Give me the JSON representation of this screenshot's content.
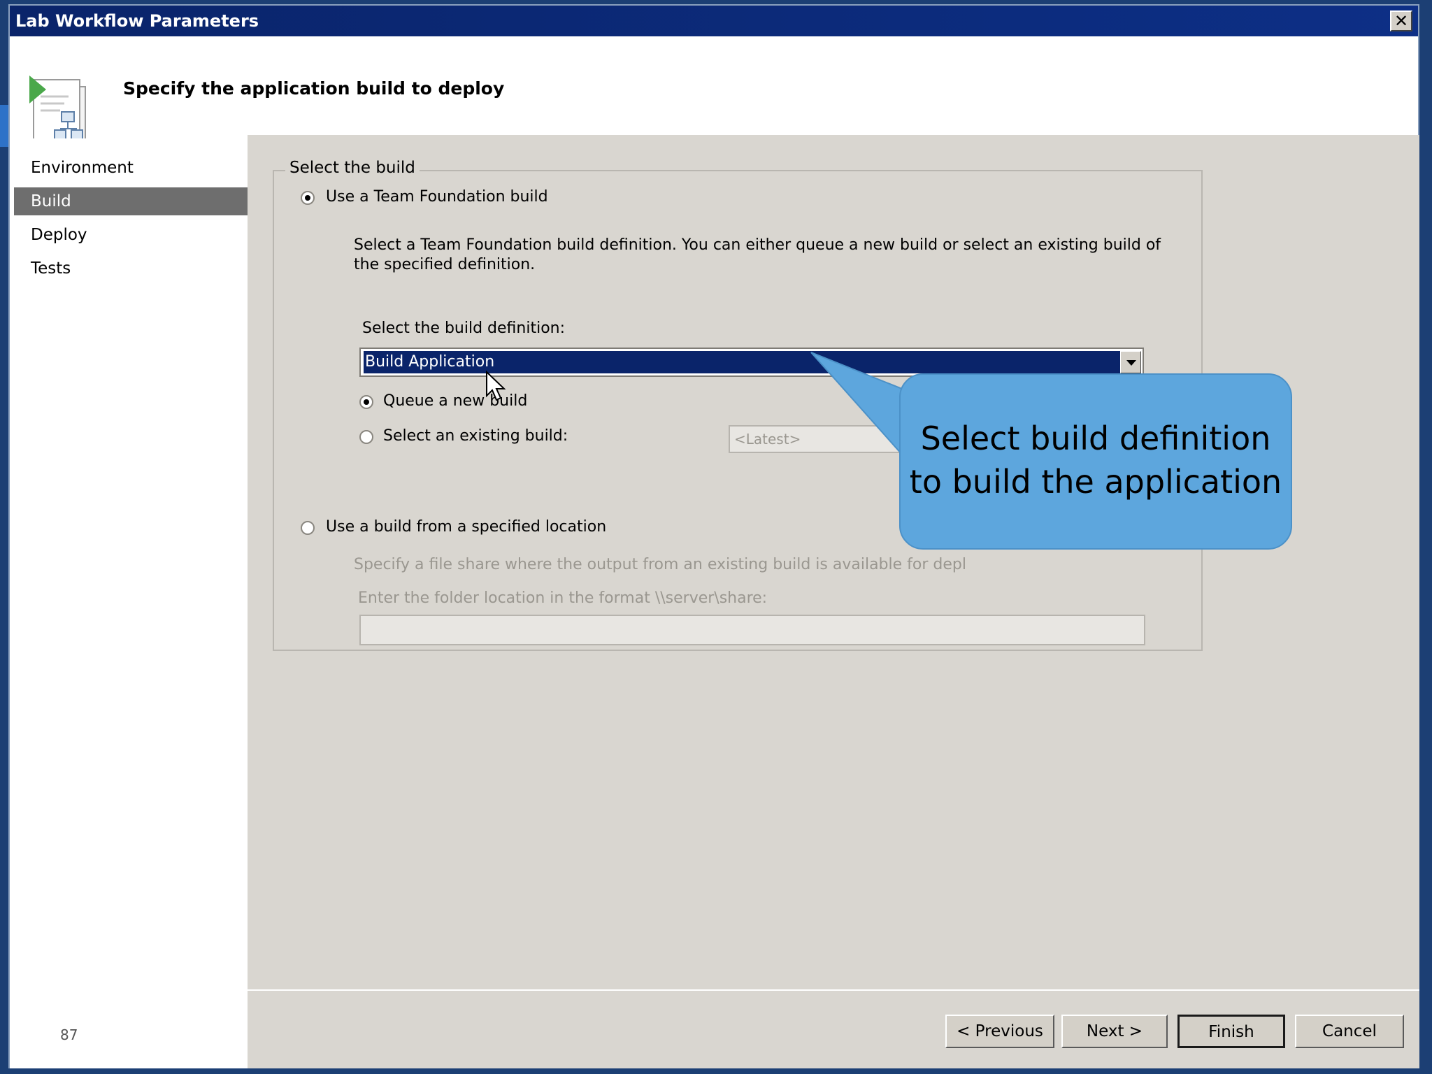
{
  "window": {
    "title": "Lab Workflow Parameters",
    "close_label": "✕"
  },
  "header": {
    "heading": "Specify the application build to deploy",
    "icon": "wizard-document-icon"
  },
  "sidebar": {
    "items": [
      {
        "label": "Environment",
        "selected": false
      },
      {
        "label": "Build",
        "selected": true
      },
      {
        "label": "Deploy",
        "selected": false
      },
      {
        "label": "Tests",
        "selected": false
      }
    ],
    "page_number": "87"
  },
  "build": {
    "group_label": "Select the build",
    "option_tfs_label": "Use a Team Foundation build",
    "option_tfs_selected": true,
    "tfs_description": "Select a Team Foundation build definition. You can either queue a new build or select an existing build of the specified definition.",
    "definition_label": "Select the build definition:",
    "definition_value": "Build Application",
    "queue_new_label": "Queue a new build",
    "queue_new_selected": true,
    "select_existing_label": "Select an existing build:",
    "existing_build_value": "<Latest>",
    "option_location_label": "Use a build from a specified location",
    "location_description": "Specify a file share where the output from an existing build is available for depl",
    "folder_label": "Enter the folder location in the format \\\\server\\share:",
    "folder_value": ""
  },
  "buttons": {
    "previous": "< Previous",
    "next": "Next >",
    "finish": "Finish",
    "cancel": "Cancel"
  },
  "callout": {
    "line1": "Select build definition",
    "line2": "to build the application"
  },
  "colors": {
    "title_bar": "#0a246a",
    "dialog_bg": "#d9d6d0",
    "selected_nav": "#6e6e6e",
    "callout": "#5da6dd"
  }
}
